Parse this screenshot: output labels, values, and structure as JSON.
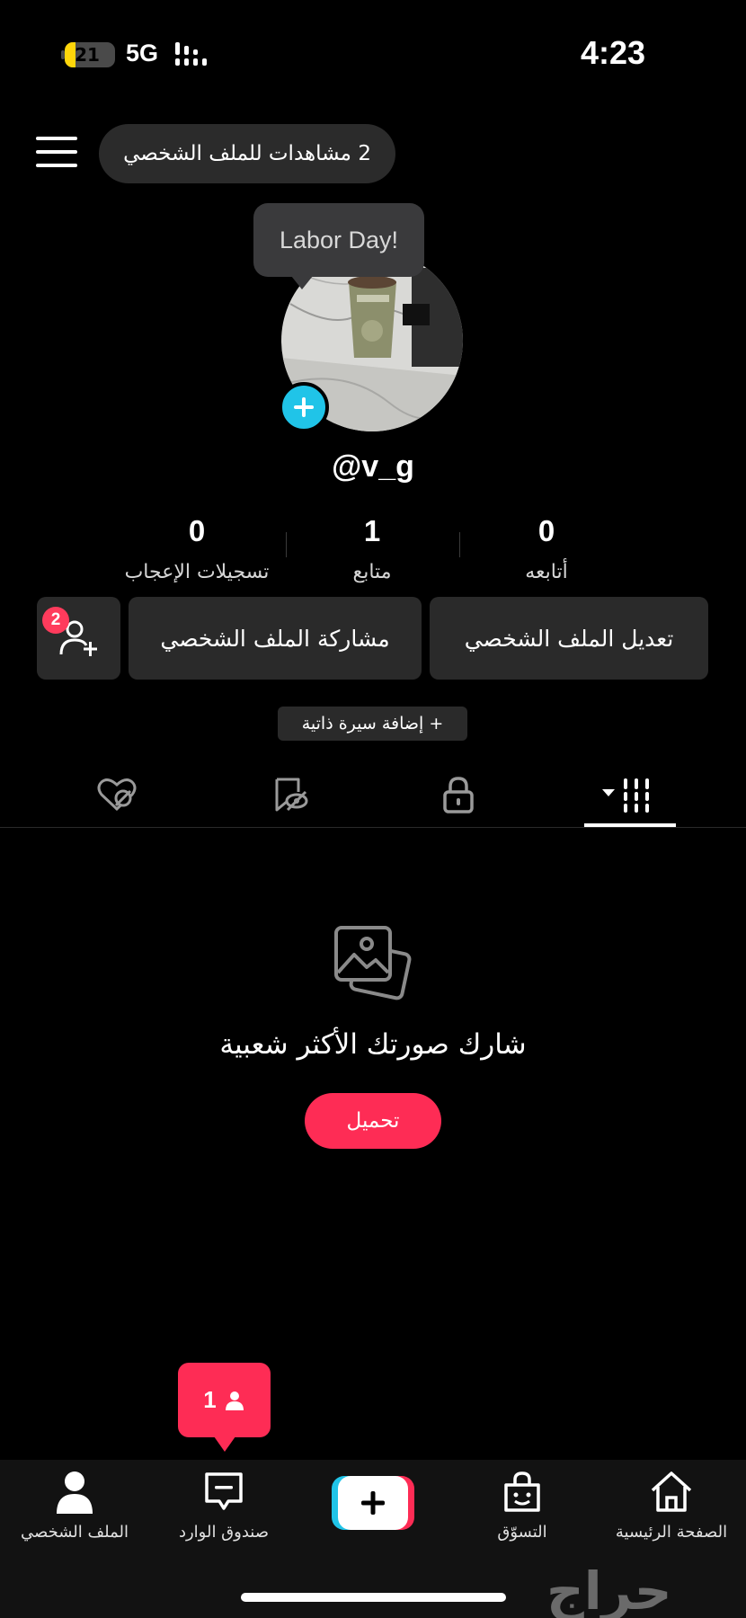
{
  "status_bar": {
    "battery_level": "21",
    "network": "5G",
    "time": "4:23",
    "battery_color": "#ffd60a"
  },
  "header": {
    "profile_views": "2 مشاهدات للملف الشخصي"
  },
  "profile": {
    "event_bubble": "Labor Day!",
    "username": "@v_g",
    "stats": [
      {
        "value": "0",
        "label": "تسجيلات الإعجاب"
      },
      {
        "value": "1",
        "label": "متابع"
      },
      {
        "value": "0",
        "label": "أتابعه"
      }
    ]
  },
  "actions": {
    "edit_profile": "تعديل الملف الشخصي",
    "share_profile": "مشاركة الملف الشخصي",
    "friend_badge": "2",
    "add_bio": "+ إضافة سيرة ذاتية"
  },
  "tabs": {
    "active": "videos",
    "items": [
      "liked-private-icon",
      "favorites-private-icon",
      "lock-icon",
      "grid-icon"
    ]
  },
  "empty_state": {
    "text": "شارك صورتك الأكثر شعبية",
    "upload_button": "تحميل"
  },
  "notification_popup": {
    "count": "1"
  },
  "bottom_nav": {
    "profile": "الملف الشخصي",
    "inbox": "صندوق الوارد",
    "shop": "التسوّق",
    "home": "الصفحة الرئيسية"
  },
  "watermark": "حراج",
  "colors": {
    "accent": "#fe2c55",
    "cyan": "#20c4e8",
    "background": "#000000"
  }
}
